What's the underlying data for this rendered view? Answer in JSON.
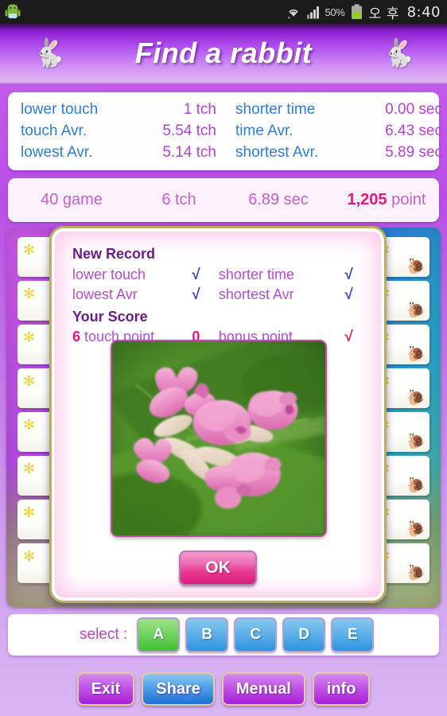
{
  "statusbar": {
    "robot_icon": "android-robot-icon",
    "wifi_icon": "wifi-icon",
    "signal_icon": "cellular-signal-icon",
    "battery_percent": "50%",
    "battery_icon": "battery-icon",
    "ampm": "오 후",
    "time": "8:40"
  },
  "header": {
    "title": "Find a rabbit",
    "rabbit_left": "🐇",
    "rabbit_right": "🐇"
  },
  "stats": {
    "rows": [
      {
        "label_a": "lower touch",
        "value_a": "1 tch",
        "label_b": "shorter time",
        "value_b": "0.00 sec"
      },
      {
        "label_a": "touch Avr.",
        "value_a": "5.54 tch",
        "label_b": "time Avr.",
        "value_b": "6.43 sec"
      },
      {
        "label_a": "lowest Avr.",
        "value_a": "5.14 tch",
        "label_b": "shortest Avr.",
        "value_b": "5.89 sec"
      }
    ],
    "label_color": "#2a7de1",
    "value_color": "#b640d8"
  },
  "score_bar": {
    "games_num": "40",
    "games_unit": " game",
    "touch_num": "6",
    "touch_unit": " tch",
    "time_num": "6.89",
    "time_unit": " sec",
    "point_num": "1,205",
    "point_unit": " point",
    "num_color": "#e8177f",
    "unit_color": "#c95bd1"
  },
  "board": {
    "tile_sun_icon": "sun-icon",
    "tile_snail_icon": "snail-icon",
    "tile_sun_glyph": "✻",
    "tile_snail_glyph": "🐌",
    "tile_count_per_column": 8
  },
  "dialog": {
    "record_title": "New Record",
    "record_rows": [
      {
        "label_left": "lower touch",
        "check_left": "√",
        "label_right": "shorter time",
        "check_right": "√"
      },
      {
        "label_left": "lowest Avr",
        "check_left": "√",
        "label_right": "shortest Avr",
        "check_right": "√"
      }
    ],
    "score_title": "Your Score",
    "touch_num": "6",
    "touch_label": " touch point",
    "bonus_num": "0",
    "bonus_label": "bonus point",
    "bonus_check": "√",
    "check_color": "#3241c8",
    "bonus_check_color": "#e01b5a",
    "image_alt": "pink-flower-photo",
    "ok_label": "OK"
  },
  "select": {
    "label": "select :",
    "options": [
      {
        "letter": "A",
        "selected": true
      },
      {
        "letter": "B",
        "selected": false
      },
      {
        "letter": "C",
        "selected": false
      },
      {
        "letter": "D",
        "selected": false
      },
      {
        "letter": "E",
        "selected": false
      }
    ],
    "selected_color": "#3fbf33",
    "unselected_color": "#2e93e0"
  },
  "bottom": {
    "buttons": [
      {
        "label": "Exit",
        "color": "purple"
      },
      {
        "label": "Share",
        "color": "blue"
      },
      {
        "label": "Menual",
        "color": "purple"
      },
      {
        "label": "info",
        "color": "purple"
      }
    ]
  }
}
